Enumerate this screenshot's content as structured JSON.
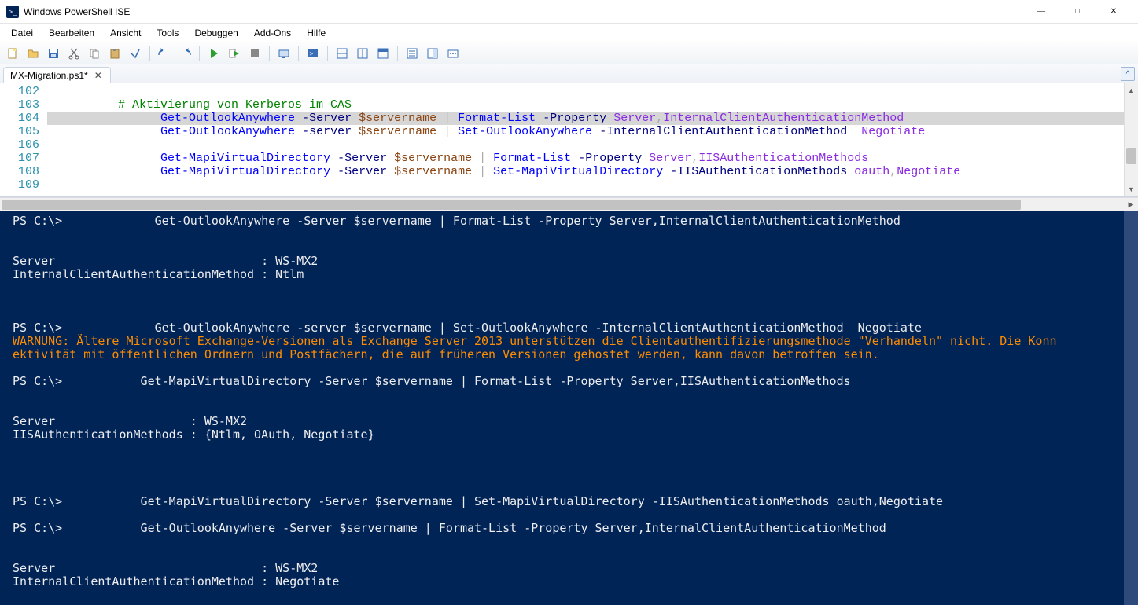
{
  "window": {
    "title": "Windows PowerShell ISE",
    "app_icon_text": ">_"
  },
  "menubar": [
    "Datei",
    "Bearbeiten",
    "Ansicht",
    "Tools",
    "Debuggen",
    "Add-Ons",
    "Hilfe"
  ],
  "toolbar_icons": [
    "new-file-icon",
    "open-file-icon",
    "save-icon",
    "cut-icon",
    "copy-icon",
    "paste-icon",
    "clear-icon",
    "|",
    "undo-icon",
    "redo-icon",
    "|",
    "run-icon",
    "run-selection-icon",
    "stop-icon",
    "|",
    "remote-icon",
    "|",
    "new-remote-tab-icon",
    "|",
    "pane-both-icon",
    "pane-script-icon",
    "pane-console-icon",
    "|",
    "show-commands-icon",
    "show-addon-icon",
    "options-icon"
  ],
  "tab": {
    "label": "MX-Migration.ps1*",
    "modified": true
  },
  "editor": {
    "line_numbers": [
      "102",
      "103",
      "104",
      "105",
      "106",
      "107",
      "108",
      "109"
    ],
    "lines": [
      {
        "segments": [
          {
            "text": "",
            "class": ""
          }
        ]
      },
      {
        "segments": [
          {
            "text": "          # Aktivierung von Kerberos im CAS",
            "class": "c-comment"
          }
        ]
      },
      {
        "highlighted": true,
        "segments": [
          {
            "text": "                ",
            "class": ""
          },
          {
            "text": "Get-OutlookAnywhere",
            "class": "c-cmdlet"
          },
          {
            "text": " -Server ",
            "class": "c-param"
          },
          {
            "text": "$servername",
            "class": "c-var"
          },
          {
            "text": " ",
            "class": ""
          },
          {
            "text": "|",
            "class": "c-pipe"
          },
          {
            "text": " ",
            "class": ""
          },
          {
            "text": "Format-List",
            "class": "c-cmdlet"
          },
          {
            "text": " -Property ",
            "class": "c-param"
          },
          {
            "text": "Server",
            "class": "c-arg"
          },
          {
            "text": ",",
            "class": "c-pipe"
          },
          {
            "text": "InternalClientAuthenticationMethod",
            "class": "c-arg"
          }
        ]
      },
      {
        "segments": [
          {
            "text": "                ",
            "class": ""
          },
          {
            "text": "Get-OutlookAnywhere",
            "class": "c-cmdlet"
          },
          {
            "text": " -server ",
            "class": "c-param"
          },
          {
            "text": "$servername",
            "class": "c-var"
          },
          {
            "text": " ",
            "class": ""
          },
          {
            "text": "|",
            "class": "c-pipe"
          },
          {
            "text": " ",
            "class": ""
          },
          {
            "text": "Set-OutlookAnywhere",
            "class": "c-cmdlet"
          },
          {
            "text": " -InternalClientAuthenticationMethod  ",
            "class": "c-param"
          },
          {
            "text": "Negotiate",
            "class": "c-arg"
          }
        ]
      },
      {
        "segments": [
          {
            "text": "",
            "class": ""
          }
        ]
      },
      {
        "segments": [
          {
            "text": "                ",
            "class": ""
          },
          {
            "text": "Get-MapiVirtualDirectory",
            "class": "c-cmdlet"
          },
          {
            "text": " -Server ",
            "class": "c-param"
          },
          {
            "text": "$servername",
            "class": "c-var"
          },
          {
            "text": " ",
            "class": ""
          },
          {
            "text": "|",
            "class": "c-pipe"
          },
          {
            "text": " ",
            "class": ""
          },
          {
            "text": "Format-List",
            "class": "c-cmdlet"
          },
          {
            "text": " -Property ",
            "class": "c-param"
          },
          {
            "text": "Server",
            "class": "c-arg"
          },
          {
            "text": ",",
            "class": "c-pipe"
          },
          {
            "text": "IISAuthenticationMethods",
            "class": "c-arg"
          }
        ]
      },
      {
        "segments": [
          {
            "text": "                ",
            "class": ""
          },
          {
            "text": "Get-MapiVirtualDirectory",
            "class": "c-cmdlet"
          },
          {
            "text": " -Server ",
            "class": "c-param"
          },
          {
            "text": "$servername",
            "class": "c-var"
          },
          {
            "text": " ",
            "class": ""
          },
          {
            "text": "|",
            "class": "c-pipe"
          },
          {
            "text": " ",
            "class": ""
          },
          {
            "text": "Set-MapiVirtualDirectory",
            "class": "c-cmdlet"
          },
          {
            "text": " -IISAuthenticationMethods ",
            "class": "c-param"
          },
          {
            "text": "oauth",
            "class": "c-arg"
          },
          {
            "text": ",",
            "class": "c-pipe"
          },
          {
            "text": "Negotiate",
            "class": "c-arg"
          }
        ]
      },
      {
        "segments": [
          {
            "text": "",
            "class": ""
          }
        ]
      }
    ]
  },
  "console": {
    "lines": [
      {
        "class": "prompt-white",
        "text": "PS C:\\>             Get-OutlookAnywhere -Server $servername | Format-List -Property Server,InternalClientAuthenticationMethod"
      },
      {
        "class": "",
        "text": ""
      },
      {
        "class": "",
        "text": ""
      },
      {
        "class": "prompt-white",
        "text": "Server                             : WS-MX2"
      },
      {
        "class": "prompt-white",
        "text": "InternalClientAuthenticationMethod : Ntlm"
      },
      {
        "class": "",
        "text": ""
      },
      {
        "class": "",
        "text": ""
      },
      {
        "class": "",
        "text": ""
      },
      {
        "class": "prompt-white",
        "text": "PS C:\\>             Get-OutlookAnywhere -server $servername | Set-OutlookAnywhere -InternalClientAuthenticationMethod  Negotiate"
      },
      {
        "class": "warning",
        "text": "WARNUNG: Ältere Microsoft Exchange-Versionen als Exchange Server 2013 unterstützen die Clientauthentifizierungsmethode \"Verhandeln\" nicht. Die Konn"
      },
      {
        "class": "warning",
        "text": "ektivität mit öffentlichen Ordnern und Postfächern, die auf früheren Versionen gehostet werden, kann davon betroffen sein."
      },
      {
        "class": "",
        "text": ""
      },
      {
        "class": "prompt-white",
        "text": "PS C:\\>           Get-MapiVirtualDirectory -Server $servername | Format-List -Property Server,IISAuthenticationMethods"
      },
      {
        "class": "",
        "text": ""
      },
      {
        "class": "",
        "text": ""
      },
      {
        "class": "prompt-white",
        "text": "Server                   : WS-MX2"
      },
      {
        "class": "prompt-white",
        "text": "IISAuthenticationMethods : {Ntlm, OAuth, Negotiate}"
      },
      {
        "class": "",
        "text": ""
      },
      {
        "class": "",
        "text": ""
      },
      {
        "class": "",
        "text": ""
      },
      {
        "class": "",
        "text": ""
      },
      {
        "class": "prompt-white",
        "text": "PS C:\\>           Get-MapiVirtualDirectory -Server $servername | Set-MapiVirtualDirectory -IISAuthenticationMethods oauth,Negotiate"
      },
      {
        "class": "",
        "text": ""
      },
      {
        "class": "prompt-white",
        "text": "PS C:\\>           Get-OutlookAnywhere -Server $servername | Format-List -Property Server,InternalClientAuthenticationMethod"
      },
      {
        "class": "",
        "text": ""
      },
      {
        "class": "",
        "text": ""
      },
      {
        "class": "prompt-white",
        "text": "Server                             : WS-MX2"
      },
      {
        "class": "prompt-white",
        "text": "InternalClientAuthenticationMethod : Negotiate"
      },
      {
        "class": "",
        "text": ""
      }
    ]
  }
}
